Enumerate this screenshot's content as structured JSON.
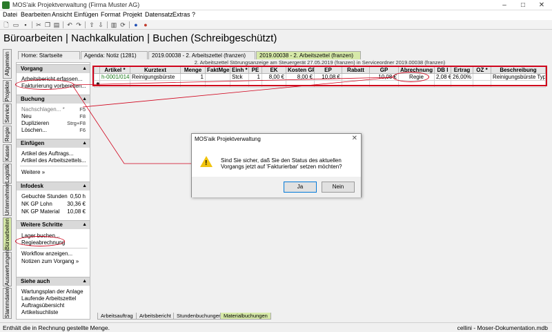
{
  "window": {
    "title": "MOS'aik Projektverwaltung (Firma Muster AG)"
  },
  "menu": [
    "Datei",
    "Bearbeiten",
    "Ansicht",
    "Einfügen",
    "Format",
    "Projekt",
    "Datensatz",
    "Extras",
    "?"
  ],
  "page_title": "Büroarbeiten | Nachkalkulation | Buchen (Schreibgeschützt)",
  "vertical_nav": [
    "Allgemein",
    "Projekte",
    "Service",
    "Regie",
    "Kasse",
    "Logistik",
    "Unternehmer",
    "Büroarbeiten",
    "Auswertungen",
    "Stammdaten"
  ],
  "doc_tabs": [
    "Home: Startseite",
    "Agenda: Notiz (1281)",
    "2019.00038 - 2. Arbeitszettel (franzen)",
    "2019.00038 - 2. Arbeitszettel (franzen)"
  ],
  "info_line": "2. Arbeitszettel Störungsanzeige am Steuergerät 27.05.2019 (franzen) in Serviceordner 2019.00038 (franzen)",
  "sections": {
    "vorgang": {
      "title": "Vorgang",
      "items": [
        "Arbeitsbericht erfassen...",
        "Fakturierung vorbereiten..."
      ]
    },
    "buchung": {
      "title": "Buchung",
      "items": [
        {
          "label": "Nachschlagen... *",
          "shortcut": "F5"
        },
        {
          "label": "Neu",
          "shortcut": "F8"
        },
        {
          "label": "Duplizieren",
          "shortcut": "Strg+F8"
        },
        {
          "label": "Löschen...",
          "shortcut": "F6"
        }
      ]
    },
    "einfuegen": {
      "title": "Einfügen",
      "items": [
        "Artikel des Auftrags...",
        "Artikel des Arbeitszettels...",
        "Weitere »"
      ]
    },
    "infodesk": {
      "title": "Infodesk",
      "items": [
        {
          "label": "Gebuchte Stunden",
          "value": "0,50 h"
        },
        {
          "label": "NK GP Lohn",
          "value": "30,36 €"
        },
        {
          "label": "NK GP Material",
          "value": "10,08 €"
        }
      ]
    },
    "weitere": {
      "title": "Weitere Schritte",
      "items": [
        "Lager buchen...",
        "Regieabrechnung",
        "Workflow anzeigen...",
        "Notizen zum Vorgang »"
      ]
    },
    "siehe": {
      "title": "Siehe auch",
      "items": [
        "Wartungsplan der Anlage",
        "Laufende Arbeitszettel",
        "Auftragsübersicht",
        "Artikelsuchliste"
      ]
    }
  },
  "grid": {
    "headers": [
      "Artikel *",
      "Kurztext",
      "Menge",
      "FaktMge",
      "Einh *",
      "PE",
      "EK",
      "Kosten GP",
      "EP",
      "Rabatt",
      "GP",
      "Abrechnung *",
      "DB I",
      "Ertrag",
      "OZ *",
      "Beschreibung"
    ],
    "row": [
      "h-0001/014",
      "Reinigungsbürste",
      "1",
      "",
      "Stck",
      "1",
      "8,00 €",
      "8,00 €",
      "10,08 €",
      "",
      "10,08 €",
      "Regie",
      "2,08 €",
      "26,00%",
      "",
      "Reinigungsbürste Typ F"
    ],
    "new_row_marker": "✱"
  },
  "bottom_tabs": [
    "Arbeitsauftrag",
    "Arbeitsbericht",
    "Stundenbuchungen",
    "Materialbuchungen"
  ],
  "status": {
    "left": "Enthält die in Rechnung gestellte Menge.",
    "right": "cellini - Moser-Dokumentation.mdb"
  },
  "dialog": {
    "title": "MOS'aik Projektverwaltung",
    "message": "Sind Sie sicher, daß Sie den Status des aktuellen Vorgangs jetzt auf 'Fakturierbar' setzen möchten?",
    "yes": "Ja",
    "no": "Nein"
  },
  "colors": {
    "highlight": "#d0021b",
    "active_tab": "#d6e9a8",
    "article_link": "#1a7a1a"
  }
}
